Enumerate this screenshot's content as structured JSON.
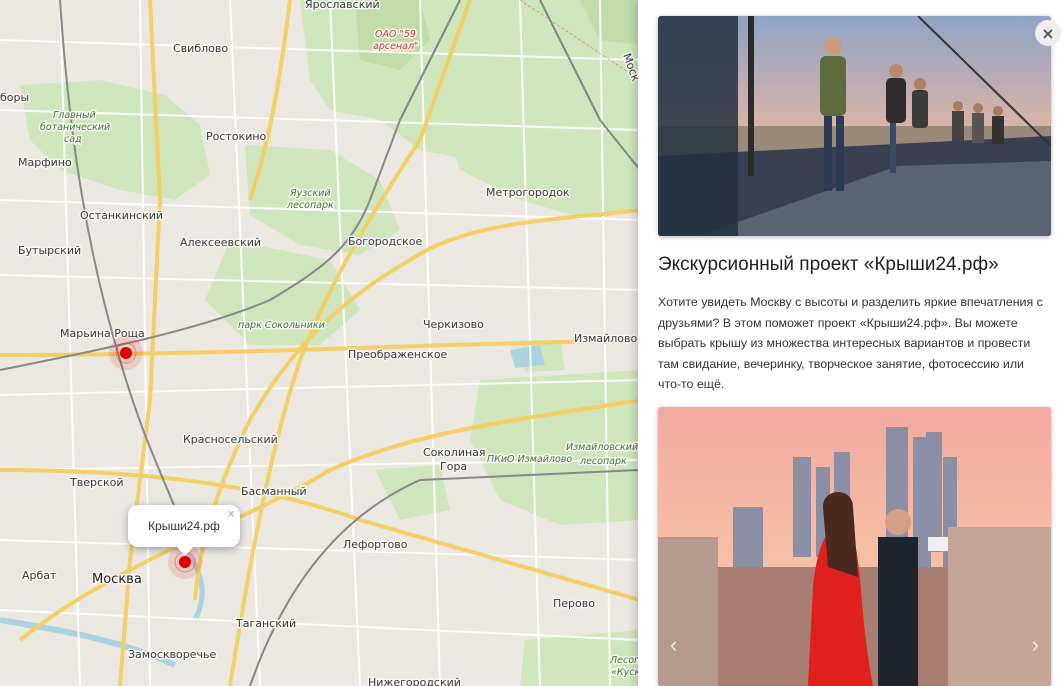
{
  "map": {
    "labels": {
      "yaroslavsky": "Ярославский",
      "oao": "ОАО \"59",
      "arsenal": "арсенал\"",
      "sviblovo": "Свиблово",
      "bory": "боры",
      "botanic1": "Главный",
      "botanic2": "ботанический",
      "botanic3": "сад",
      "rostokino": "Ростокино",
      "marfino": "Марфино",
      "yauza1": "Яузский",
      "yauza2": "лесопарк",
      "metrogorodok": "Метрогородок",
      "ostankinsky": "Останкинский",
      "alekseevsky": "Алексеевский",
      "butyrsky": "Бутырский",
      "bogorodskoe": "Богородское",
      "maryina_roshcha": "Марьина Роща",
      "sokolniki": "парк Сокольники",
      "cherkizovo": "Черкизово",
      "izmaylovo": "Измайлово",
      "preobrazhenskoe": "Преображенское",
      "krasnoselsky": "Красносельский",
      "sokolinaya1": "Соколиная",
      "sokolinaya2": "Гора",
      "pkio": "ПКиО Измайлово",
      "izm_les1": "Измайловский",
      "izm_les2": "лесопарк",
      "tverskoy": "Тверской",
      "basmanny": "Басманный",
      "lefortovo": "Лефортово",
      "arbat": "Арбат",
      "moskva": "Москва",
      "perovo": "Перово",
      "tagansky": "Таганский",
      "zamoskvorechye": "Замоскворечье",
      "nizhegorodsky": "Нижегородский",
      "lesopark_bottom": "Лесопа",
      "kusk": "«Куск",
      "road_mosk": "Моск"
    },
    "popup": {
      "label": "Крыши24.рф",
      "close": "×"
    },
    "markers": [
      "Марьина Роща marker",
      "Крыши24.рф marker"
    ]
  },
  "panel": {
    "close": "×",
    "title": "Экскурсионный проект «Крыши24.рф»",
    "description": "Хотите увидеть Москву с высоты и разделить яркие впечатления с друзьями? В этом поможет проект «Крыши24.рф». Вы можете выбрать крышу из множества интересных вариантов и провести там свидание, вечеринку, творческое занятие, фотосессию или что-то ещё.",
    "prev": "‹",
    "next": "›"
  },
  "colors": {
    "park": "#c8e0b4",
    "marker": "#e00000",
    "road_major": "#f6d66b",
    "road_minor": "#ffffff"
  }
}
